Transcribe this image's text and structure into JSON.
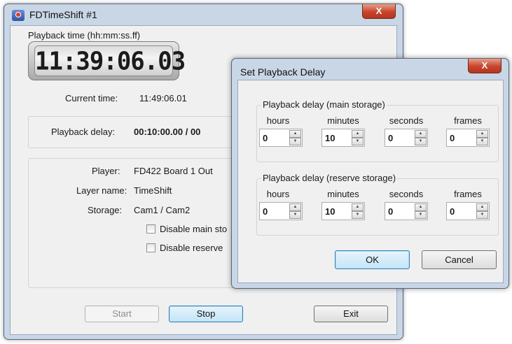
{
  "main_window": {
    "title": "FDTimeShift #1",
    "close_glyph": "X",
    "playback_time_label": "Playback time (hh:mm:ss.ff)",
    "lcd_time": "11:39:06.03",
    "current_time_label": "Current time:",
    "current_time_value": "11:49:06.01",
    "playback_delay_label": "Playback delay:",
    "playback_delay_value": "00:10:00.00 / 00",
    "player_label": "Player:",
    "player_value": "FD422 Board 1 Out",
    "layer_label": "Layer name:",
    "layer_value": "TimeShift",
    "storage_label": "Storage:",
    "storage_value": "Cam1 / Cam2",
    "disable_main_label": "Disable main sto",
    "disable_reserve_label": "Disable reserve",
    "start_label": "Start",
    "stop_label": "Stop",
    "exit_label": "Exit"
  },
  "dialog": {
    "title": "Set Playback Delay",
    "close_glyph": "X",
    "main_group": {
      "title": "Playback delay (main storage)",
      "fields": [
        {
          "label": "hours",
          "value": "0"
        },
        {
          "label": "minutes",
          "value": "10"
        },
        {
          "label": "seconds",
          "value": "0"
        },
        {
          "label": "frames",
          "value": "0"
        }
      ]
    },
    "reserve_group": {
      "title": "Playback delay (reserve storage)",
      "fields": [
        {
          "label": "hours",
          "value": "0"
        },
        {
          "label": "minutes",
          "value": "10"
        },
        {
          "label": "seconds",
          "value": "0"
        },
        {
          "label": "frames",
          "value": "0"
        }
      ]
    },
    "ok_label": "OK",
    "cancel_label": "Cancel"
  }
}
